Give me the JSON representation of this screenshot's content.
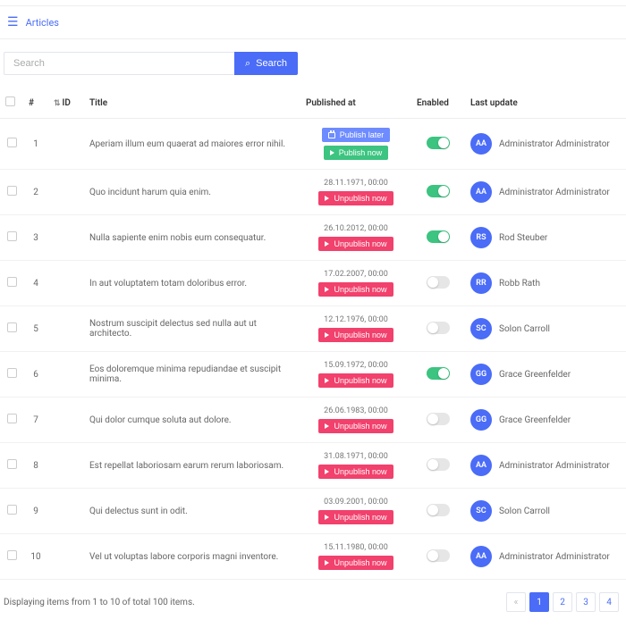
{
  "header": {
    "breadcrumb": "Articles"
  },
  "search": {
    "placeholder": "Search",
    "button_label": "Search"
  },
  "columns": {
    "num": "#",
    "id": "ID",
    "title": "Title",
    "published_at": "Published at",
    "enabled": "Enabled",
    "last_update": "Last update"
  },
  "buttons": {
    "publish_later": "Publish later",
    "publish_now": "Publish now",
    "unpublish_now": "Unpublish now"
  },
  "rows": [
    {
      "num": "1",
      "title": "Aperiam illum eum quaerat ad maiores error nihil.",
      "date": "",
      "state": "publish",
      "enabled": true,
      "initials": "AA",
      "user": "Administrator Administrator"
    },
    {
      "num": "2",
      "title": "Quo incidunt harum quia enim.",
      "date": "28.11.1971, 00:00",
      "state": "unpublish",
      "enabled": true,
      "initials": "AA",
      "user": "Administrator Administrator"
    },
    {
      "num": "3",
      "title": "Nulla sapiente enim nobis eum consequatur.",
      "date": "26.10.2012, 00:00",
      "state": "unpublish",
      "enabled": true,
      "initials": "RS",
      "user": "Rod Steuber"
    },
    {
      "num": "4",
      "title": "In aut voluptatem totam doloribus error.",
      "date": "17.02.2007, 00:00",
      "state": "unpublish",
      "enabled": false,
      "initials": "RR",
      "user": "Robb Rath"
    },
    {
      "num": "5",
      "title": "Nostrum suscipit delectus sed nulla aut ut architecto.",
      "date": "12.12.1976, 00:00",
      "state": "unpublish",
      "enabled": false,
      "initials": "SC",
      "user": "Solon Carroll"
    },
    {
      "num": "6",
      "title": "Eos doloremque minima repudiandae et suscipit minima.",
      "date": "15.09.1972, 00:00",
      "state": "unpublish",
      "enabled": true,
      "initials": "GG",
      "user": "Grace Greenfelder"
    },
    {
      "num": "7",
      "title": "Qui dolor cumque soluta aut dolore.",
      "date": "26.06.1983, 00:00",
      "state": "unpublish",
      "enabled": false,
      "initials": "GG",
      "user": "Grace Greenfelder"
    },
    {
      "num": "8",
      "title": "Est repellat laboriosam earum rerum laboriosam.",
      "date": "31.08.1971, 00:00",
      "state": "unpublish",
      "enabled": false,
      "initials": "AA",
      "user": "Administrator Administrator"
    },
    {
      "num": "9",
      "title": "Qui delectus sunt in odit.",
      "date": "03.09.2001, 00:00",
      "state": "unpublish",
      "enabled": false,
      "initials": "SC",
      "user": "Solon Carroll"
    },
    {
      "num": "10",
      "title": "Vel ut voluptas labore corporis magni inventore.",
      "date": "15.11.1980, 00:00",
      "state": "unpublish",
      "enabled": false,
      "initials": "AA",
      "user": "Administrator Administrator"
    }
  ],
  "footer": {
    "summary": "Displaying items from 1 to 10 of total 100 items.",
    "pages": [
      "1",
      "2",
      "3",
      "4"
    ],
    "active_page": "1",
    "prev": "«"
  }
}
